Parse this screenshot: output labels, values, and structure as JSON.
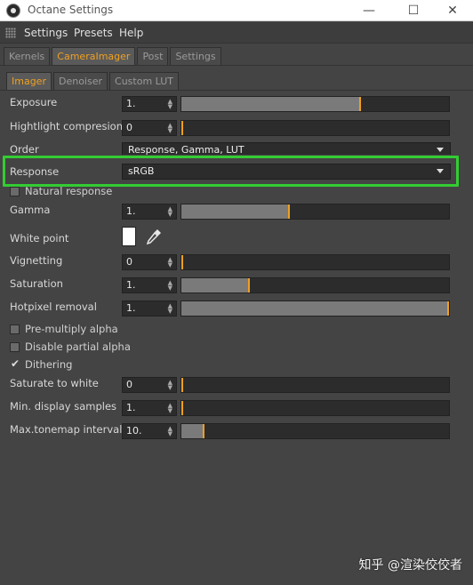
{
  "window": {
    "title": "Octane Settings",
    "minimize": "—",
    "maximize": "☐",
    "close": "✕"
  },
  "menu": [
    "Settings",
    "Presets",
    "Help"
  ],
  "tabs": [
    "Kernels",
    "CameraImager",
    "Post",
    "Settings"
  ],
  "subtabs": [
    "Imager",
    "Denoiser",
    "Custom LUT"
  ],
  "fields": {
    "exposure": {
      "label": "Exposure",
      "value": "1.",
      "fraction": 0.67
    },
    "highlight": {
      "label": "Hightlight compresion",
      "value": "0",
      "fraction": 0.0
    },
    "order": {
      "label": "Order",
      "value": "Response, Gamma, LUT"
    },
    "response": {
      "label": "Response",
      "value": "sRGB"
    },
    "natural_response": {
      "label": "Natural response",
      "checked": false
    },
    "gamma": {
      "label": "Gamma",
      "value": "1.",
      "fraction": 0.4
    },
    "white_point": {
      "label": "White point",
      "color": "#ffffff"
    },
    "vignetting": {
      "label": "Vignetting",
      "value": "0",
      "fraction": 0.0
    },
    "saturation": {
      "label": "Saturation",
      "value": "1.",
      "fraction": 0.25
    },
    "hotpixel": {
      "label": "Hotpixel removal",
      "value": "1.",
      "fraction": 1.0
    },
    "premultiply": {
      "label": "Pre-multiply alpha",
      "checked": false
    },
    "disable_partial": {
      "label": "Disable partial alpha",
      "checked": false
    },
    "dithering": {
      "label": "Dithering",
      "checked": true
    },
    "saturate_white": {
      "label": "Saturate to white",
      "value": "0",
      "fraction": 0.0
    },
    "min_display": {
      "label": "Min. display samples",
      "value": "1.",
      "fraction": 0.0
    },
    "max_tonemap": {
      "label": "Max.tonemap interval",
      "value": "10.",
      "fraction": 0.08
    }
  },
  "colors": {
    "accent": "#f0a020",
    "highlight": "#33cc33",
    "panel": "#444444"
  },
  "watermark": "知乎 @渲染佼佼者"
}
